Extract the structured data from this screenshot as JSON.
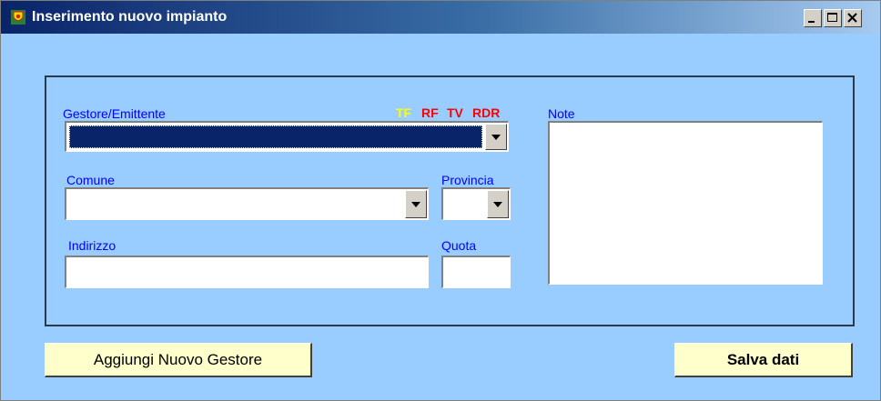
{
  "window": {
    "title": "Inserimento nuovo impianto",
    "icon": "app-logo-icon",
    "controls": [
      "minimize-icon",
      "maximize-icon",
      "close-icon"
    ]
  },
  "form": {
    "gestore_label": "Gestore/Emittente",
    "gestore_value": "",
    "tags": [
      {
        "label": "TF",
        "color": "#ffff00"
      },
      {
        "label": "RF",
        "color": "#ff0000"
      },
      {
        "label": "TV",
        "color": "#ff0000"
      },
      {
        "label": "RDR",
        "color": "#ff0000"
      }
    ],
    "note_label": "Note",
    "note_value": "",
    "comune_label": "Comune",
    "comune_value": "",
    "provincia_label": "Provincia",
    "provincia_value": "",
    "indirizzo_label": "Indirizzo",
    "indirizzo_value": "",
    "quota_label": "Quota",
    "quota_value": ""
  },
  "buttons": {
    "add_gestore": "Aggiungi Nuovo Gestore",
    "save": "Salva dati"
  },
  "colors": {
    "window_background": "#99ccff",
    "label": "#0000ff",
    "button_face": "#ffffcc",
    "selection": "#0a246a"
  }
}
